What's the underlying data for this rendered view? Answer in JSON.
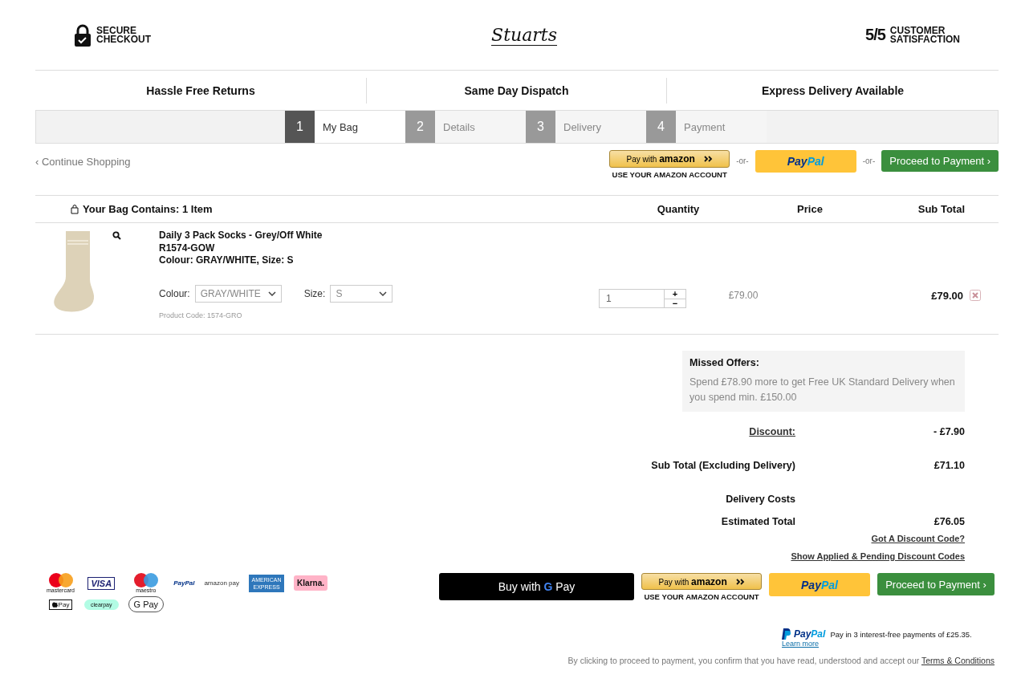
{
  "header": {
    "secure": {
      "line1": "SECURE",
      "line2": "CHECKOUT"
    },
    "logo": "Stuarts",
    "rating": {
      "mark": "5/5",
      "line1": "CUSTOMER",
      "line2": "SATISFACTION"
    }
  },
  "usps": [
    "Hassle Free Returns",
    "Same Day Dispatch",
    "Express Delivery Available"
  ],
  "steps": [
    {
      "number": "1",
      "label": "My Bag",
      "selected": true
    },
    {
      "number": "2",
      "label": "Details",
      "selected": false
    },
    {
      "number": "3",
      "label": "Delivery",
      "selected": false
    },
    {
      "number": "4",
      "label": "Payment",
      "selected": false
    }
  ],
  "top_actions": {
    "continue": "‹ Continue Shopping",
    "amazon": {
      "prefix": "Pay with",
      "brand": "amazon",
      "caption": "USE YOUR AMAZON ACCOUNT"
    },
    "or1": "-or-",
    "paypal": {
      "part1": "Pay",
      "part2": "Pal"
    },
    "or2": "-or-",
    "proceed": "Proceed to Payment ›"
  },
  "table": {
    "columns": [
      "Your Bag Contains: 1 Item",
      "Quantity",
      "Price",
      "Sub Total"
    ],
    "item": {
      "name": "Daily 3 Pack Socks - Grey/Off White",
      "sku": "R1574-GOW",
      "variant": "Colour: GRAY/WHITE, Size: S",
      "colour_label": "Colour:",
      "colour_value": "GRAY/WHITE",
      "size_label": "Size:",
      "size_value": "S",
      "product_code": "Product Code: 1574-GRO",
      "quantity": "1",
      "plus": "+",
      "minus": "−",
      "price": "£79.00",
      "subtotal": "£79.00"
    }
  },
  "missed_offers": {
    "title": "Missed Offers:",
    "text": "Spend £78.90 more to get Free UK Standard Delivery when you spend min. £150.00"
  },
  "summary": [
    {
      "label": "Discount:",
      "value": "- £7.90",
      "kind": "link"
    },
    {
      "label": "Sub Total (Excluding Delivery)",
      "value": "£71.10",
      "kind": "plain"
    },
    {
      "label": "Delivery Costs",
      "kind": "plain"
    },
    {
      "label": "Estimated Total",
      "value": "£76.05",
      "kind": "plain"
    }
  ],
  "discount_links": [
    "Got A Discount Code?",
    "Show Applied & Pending Discount Codes"
  ],
  "payment_methods": [
    {
      "kind": "mastercard",
      "text": "mastercard"
    },
    {
      "kind": "visa",
      "text": "VISA"
    },
    {
      "kind": "maestro",
      "text": "maestro"
    },
    {
      "kind": "paypal",
      "text": "PayPal"
    },
    {
      "kind": "amazonpay",
      "text": "amazon pay"
    },
    {
      "kind": "amex",
      "text": "AMERICAN EXPRESS"
    },
    {
      "kind": "klarna",
      "text": "Klarna."
    },
    {
      "kind": "applepay",
      "text": "Pay"
    },
    {
      "kind": "clearpay",
      "text": "clearpay"
    },
    {
      "kind": "gpay",
      "text": "G Pay"
    }
  ],
  "bottom_actions": {
    "gpay": {
      "prefix": "Buy with",
      "g": "G",
      "suffix": "Pay"
    },
    "amazon": {
      "prefix": "Pay with",
      "brand": "amazon",
      "caption": "USE YOUR AMAZON ACCOUNT"
    },
    "paypal": {
      "part1": "Pay",
      "part2": "Pal"
    },
    "proceed": "Proceed to Payment ›"
  },
  "paypal_credit": {
    "part1": "Pay",
    "part2": "Pal",
    "text": "Pay in 3 interest-free payments of £25.35.",
    "link": "Learn more"
  },
  "terms": {
    "text": "By clicking to proceed to payment, you confirm that you have read, understood and accept our",
    "link": "Terms & Conditions"
  }
}
